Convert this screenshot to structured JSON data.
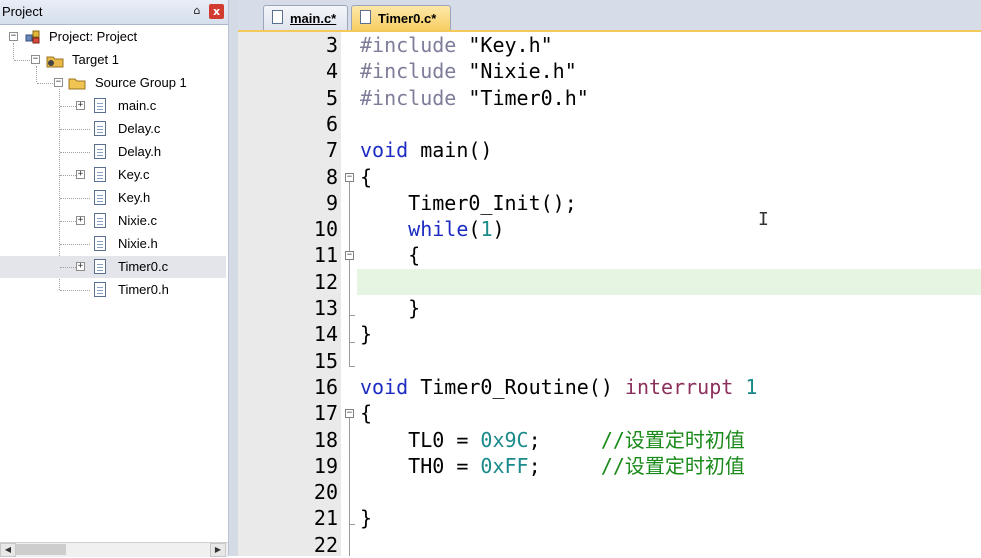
{
  "project_panel": {
    "title": "Project",
    "pin_glyph": "⌂",
    "close_glyph": "x",
    "tree": [
      {
        "label": "Project: Project",
        "icon": "project-icon"
      },
      {
        "label": "Target 1",
        "icon": "target-icon"
      },
      {
        "label": "Source Group 1",
        "icon": "folder-icon"
      },
      {
        "label": "main.c",
        "icon": "file-icon",
        "expandable": true
      },
      {
        "label": "Delay.c",
        "icon": "file-icon",
        "expandable": false
      },
      {
        "label": "Delay.h",
        "icon": "file-icon",
        "expandable": false
      },
      {
        "label": "Key.c",
        "icon": "file-icon",
        "expandable": true
      },
      {
        "label": "Key.h",
        "icon": "file-icon",
        "expandable": false
      },
      {
        "label": "Nixie.c",
        "icon": "file-icon",
        "expandable": true
      },
      {
        "label": "Nixie.h",
        "icon": "file-icon",
        "expandable": false
      },
      {
        "label": "Timer0.c",
        "icon": "file-icon",
        "expandable": true,
        "selected": true
      },
      {
        "label": "Timer0.h",
        "icon": "file-icon",
        "expandable": false
      }
    ],
    "expander_plus": "+",
    "expander_minus": "−"
  },
  "tabs": [
    {
      "label": "main.c*",
      "active": false
    },
    {
      "label": "Timer0.c*",
      "active": true
    }
  ],
  "editor": {
    "current_line": 12,
    "lines": [
      {
        "num": "3",
        "code": "#include \"Key.h\""
      },
      {
        "num": "4",
        "code": "#include \"Nixie.h\""
      },
      {
        "num": "5",
        "code": "#include \"Timer0.h\""
      },
      {
        "num": "6",
        "code": ""
      },
      {
        "num": "7",
        "code": "void main()"
      },
      {
        "num": "8",
        "code": "{"
      },
      {
        "num": "9",
        "code": "    Timer0_Init();"
      },
      {
        "num": "10",
        "code": "    while(1)"
      },
      {
        "num": "11",
        "code": "    {"
      },
      {
        "num": "12",
        "code": ""
      },
      {
        "num": "13",
        "code": "    }"
      },
      {
        "num": "14",
        "code": "}"
      },
      {
        "num": "15",
        "code": ""
      },
      {
        "num": "16",
        "code": "void Timer0_Routine() interrupt 1"
      },
      {
        "num": "17",
        "code": "{"
      },
      {
        "num": "18",
        "code": "    TL0 = 0x9C;     //设置定时初值"
      },
      {
        "num": "19",
        "code": "    TH0 = 0xFF;     //设置定时初值"
      },
      {
        "num": "20",
        "code": ""
      },
      {
        "num": "21",
        "code": "}"
      },
      {
        "num": "22",
        "code": ""
      }
    ]
  },
  "colors": {
    "current_line_bg": "#e6f5e2",
    "keyword": "#1c2bc2",
    "number": "#1a8a8a",
    "comment": "#1a8a1a",
    "preprocessor": "#7d7d9a",
    "active_tab": "#f7cf63"
  }
}
